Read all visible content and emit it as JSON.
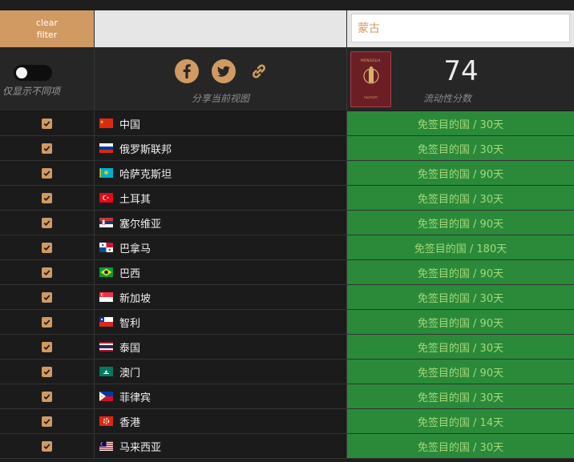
{
  "header": {
    "clear_line1": "clear",
    "clear_line2": "filter",
    "search_value": "蒙古",
    "search_placeholder": ""
  },
  "controls": {
    "only_diff_label": "仅显示不同项",
    "share_label": "分享当前视图",
    "score": "74",
    "score_label": "流动性分数",
    "passport_title": "MONGOLIA",
    "passport_sub": "ПАСПОРТ"
  },
  "colors": {
    "accent": "#d19a62",
    "visa_free": "#2a8a3a",
    "visa_text": "#a7d77a"
  },
  "rows": [
    {
      "country": "中国",
      "flag": "cn",
      "status": "免签目的国 / 30天"
    },
    {
      "country": "俄罗斯联邦",
      "flag": "ru",
      "status": "免签目的国 / 30天"
    },
    {
      "country": "哈萨克斯坦",
      "flag": "kz",
      "status": "免签目的国 / 90天"
    },
    {
      "country": "土耳其",
      "flag": "tr",
      "status": "免签目的国 / 30天"
    },
    {
      "country": "塞尔维亚",
      "flag": "rs",
      "status": "免签目的国 / 90天"
    },
    {
      "country": "巴拿马",
      "flag": "pa",
      "status": "免签目的国 / 180天"
    },
    {
      "country": "巴西",
      "flag": "br",
      "status": "免签目的国 / 90天"
    },
    {
      "country": "新加坡",
      "flag": "sg",
      "status": "免签目的国 / 30天"
    },
    {
      "country": "智利",
      "flag": "cl",
      "status": "免签目的国 / 90天"
    },
    {
      "country": "泰国",
      "flag": "th",
      "status": "免签目的国 / 30天"
    },
    {
      "country": "澳门",
      "flag": "mo",
      "status": "免签目的国 / 90天"
    },
    {
      "country": "菲律宾",
      "flag": "ph",
      "status": "免签目的国 / 30天"
    },
    {
      "country": "香港",
      "flag": "hk",
      "status": "免签目的国 / 14天"
    },
    {
      "country": "马来西亚",
      "flag": "my",
      "status": "免签目的国 / 30天"
    }
  ]
}
